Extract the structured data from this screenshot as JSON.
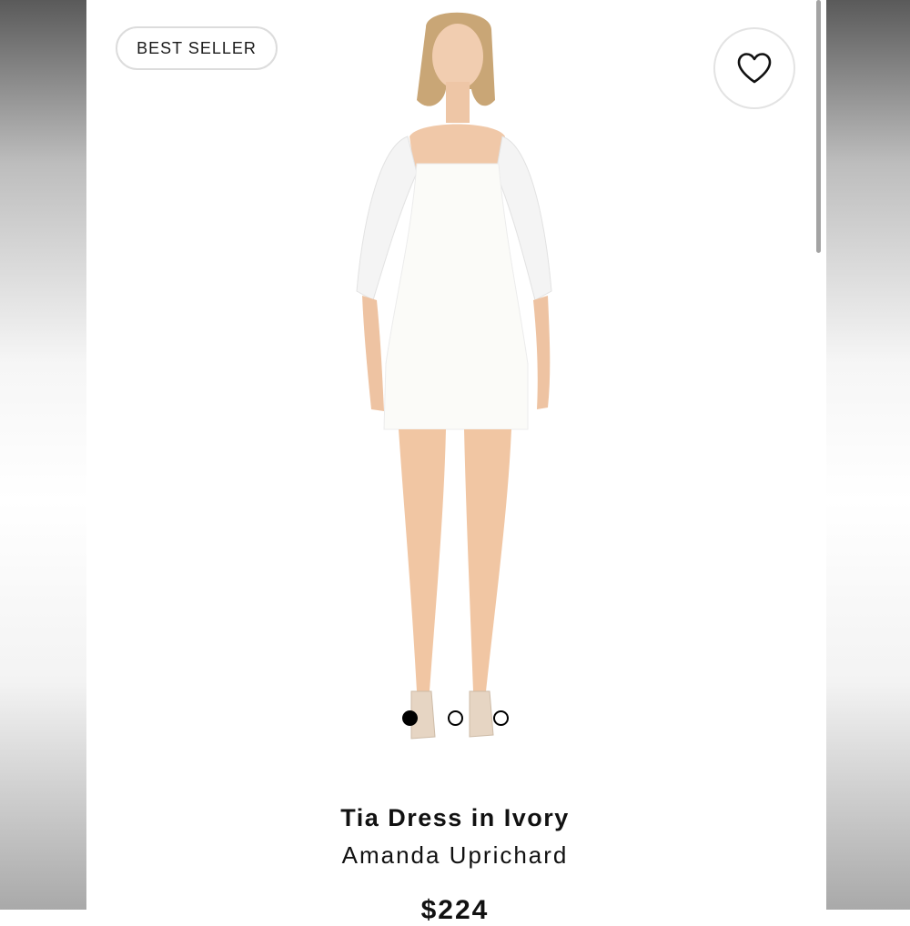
{
  "badge": {
    "label": "BEST SELLER"
  },
  "favorite": {
    "icon": "heart-icon"
  },
  "gallery": {
    "total_images": 3,
    "active_index": 0
  },
  "product": {
    "name": "Tia Dress in Ivory",
    "brand": "Amanda Uprichard",
    "price": "$224"
  },
  "colors": {
    "text": "#111111",
    "badge_border": "#dcdcdc",
    "dot": "#000000"
  }
}
